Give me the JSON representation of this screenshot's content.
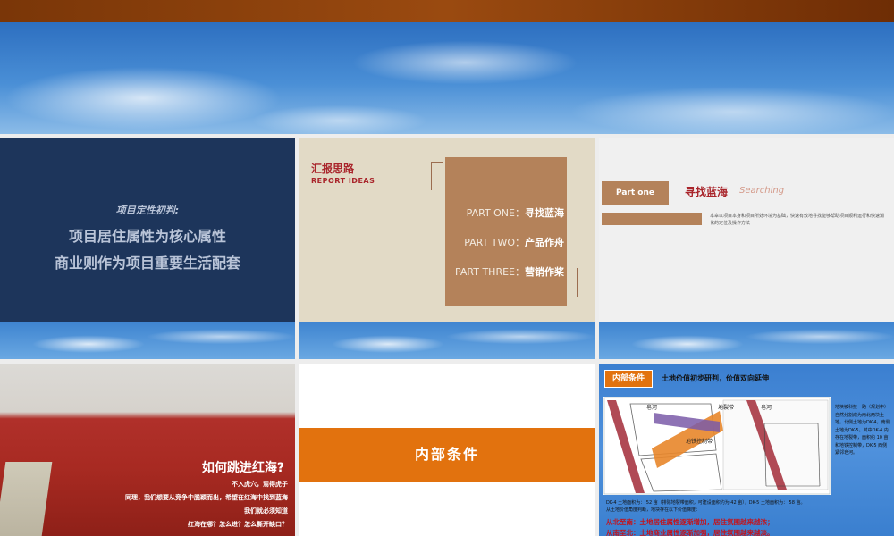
{
  "slide1": {
    "subtitle": "项目定性初判:",
    "line1": "项目居住属性为核心属性",
    "line2": "商业则作为项目重要生活配套"
  },
  "slide2": {
    "title": "汇报思路",
    "title_en": "REPORT IDEAS",
    "parts": [
      {
        "label": "PART ONE：",
        "name": "寻找蓝海"
      },
      {
        "label": "PART TWO：",
        "name": "产品作舟"
      },
      {
        "label": "PART THREE：",
        "name": "营销作桨"
      }
    ]
  },
  "slide3": {
    "tag": "Part one",
    "title_cn": "寻找蓝海",
    "title_en": "Searching",
    "description": "本章以项目本身和项目所处环境为基础，快速有效地寻找能够帮助项目顺利运行和快速消化的定位及操作方法"
  },
  "slide4": {
    "question": "如何跳进红海?",
    "lines": [
      "不入虎穴，焉得虎子",
      "同理，我们想要从竞争中脱颖而出，希望在红海中找到蓝海",
      "我们就必须知道",
      "红海在哪？怎么进？怎么撕开缺口？"
    ]
  },
  "slide5": {
    "band_title": "内部条件"
  },
  "slide6": {
    "tag": "内部条件",
    "heading": "土地价值初步研判，价值双向延伸",
    "map_labels": {
      "river_left": "皂河",
      "river_right": "皂河",
      "ground_crack": "地裂带",
      "metro_control": "地铁控制带"
    },
    "side_text": "地块被科技一路（规划中）自然分割成为南北两块土地。北侧土地为DK-4，南侧土地为DK-5。其中DK-4 内存在地裂带，面积约 10 亩和地铁控制带，DK-5 西侧紧邻皂河。",
    "info_line1": "DK-4 土地面积为： 52 亩（排除地裂带面积，可建设面积约为 42 亩），DK-5 土地面积为： 58 亩。",
    "info_line2": "从土地价值角度判断，地块存在以下价值梯度：",
    "red_line1": "从北至南：土地居住属性逐渐增加，居住氛围越来越浓；",
    "red_line2": "从南至北：土地商业属性逐渐加强，居住氛围越来越淡。",
    "colors": {
      "accent_orange": "#e2720e",
      "accent_brown": "#b4825a",
      "accent_red": "#a9252b",
      "navy": "#1d355b"
    }
  }
}
